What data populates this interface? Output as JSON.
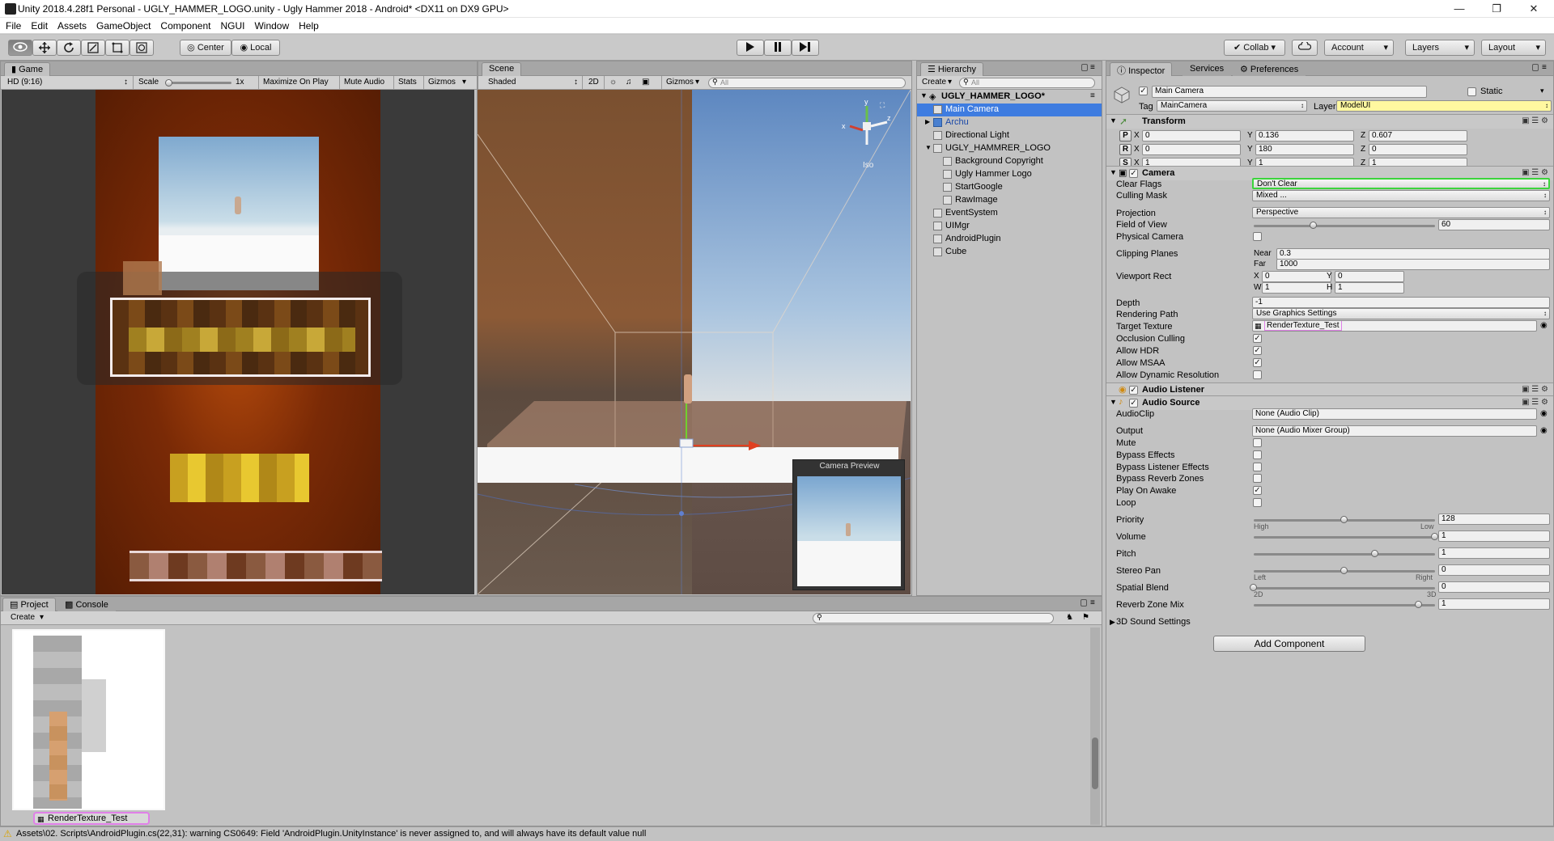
{
  "titlebar": {
    "title": "Unity 2018.4.28f1 Personal - UGLY_HAMMER_LOGO.unity - Ugly Hammer 2018 - Android* <DX11 on DX9 GPU>"
  },
  "window_controls": {
    "minimize": "—",
    "maximize": "❐",
    "close": "✕"
  },
  "menu": [
    "File",
    "Edit",
    "Assets",
    "GameObject",
    "Component",
    "NGUI",
    "Window",
    "Help"
  ],
  "toolbar": {
    "tools": [
      "view-tool-icon",
      "move-tool-icon",
      "rotate-tool-icon",
      "scale-tool-icon",
      "rect-tool-icon",
      "transform-tool-icon"
    ],
    "pivot_label": "Center",
    "space_label": "Local",
    "collab_label": "Collab",
    "account_label": "Account",
    "layers_label": "Layers",
    "layout_label": "Layout"
  },
  "game": {
    "tab": "Game",
    "resolution": "HD (9:16)",
    "scale_label": "Scale",
    "scale_value": "1x",
    "maximize": "Maximize On Play",
    "mute": "Mute Audio",
    "stats": "Stats",
    "gizmos": "Gizmos"
  },
  "scene": {
    "tab": "Scene",
    "shading": "Shaded",
    "mode_2d": "2D",
    "gizmos": "Gizmos",
    "search_placeholder": "All",
    "persp_label": "Iso",
    "preview_title": "Camera Preview"
  },
  "hierarchy": {
    "tab": "Hierarchy",
    "create": "Create",
    "search_placeholder": "All",
    "scene_name": "UGLY_HAMMER_LOGO*",
    "items": [
      {
        "label": "Main Camera",
        "depth": 1,
        "selected": true,
        "prefab": false,
        "foldout": ""
      },
      {
        "label": "Archu",
        "depth": 1,
        "selected": false,
        "prefab": true,
        "foldout": "▶"
      },
      {
        "label": "Directional Light",
        "depth": 1,
        "selected": false,
        "prefab": false,
        "foldout": ""
      },
      {
        "label": "UGLY_HAMMRER_LOGO",
        "depth": 1,
        "selected": false,
        "prefab": false,
        "foldout": "▼"
      },
      {
        "label": "Background Copyright",
        "depth": 2,
        "selected": false,
        "prefab": false,
        "foldout": ""
      },
      {
        "label": "Ugly Hammer Logo",
        "depth": 2,
        "selected": false,
        "prefab": false,
        "foldout": ""
      },
      {
        "label": "StartGoogle",
        "depth": 2,
        "selected": false,
        "prefab": false,
        "foldout": ""
      },
      {
        "label": "RawImage",
        "depth": 2,
        "selected": false,
        "prefab": false,
        "foldout": ""
      },
      {
        "label": "EventSystem",
        "depth": 1,
        "selected": false,
        "prefab": false,
        "foldout": ""
      },
      {
        "label": "UIMgr",
        "depth": 1,
        "selected": false,
        "prefab": false,
        "foldout": ""
      },
      {
        "label": "AndroidPlugin",
        "depth": 1,
        "selected": false,
        "prefab": false,
        "foldout": ""
      },
      {
        "label": "Cube",
        "depth": 1,
        "selected": false,
        "prefab": false,
        "foldout": ""
      }
    ]
  },
  "inspector": {
    "tabs": [
      "Inspector",
      "Services",
      "Preferences"
    ],
    "object_name": "Main Camera",
    "static_label": "Static",
    "tag_label": "Tag",
    "tag_value": "MainCamera",
    "layer_label": "Layer",
    "layer_value": "ModelUI",
    "transform": {
      "title": "Transform",
      "rows": [
        {
          "btn": "P",
          "x": "0",
          "y": "0.136",
          "z": "0.607"
        },
        {
          "btn": "R",
          "x": "0",
          "y": "180",
          "z": "0"
        },
        {
          "btn": "S",
          "x": "1",
          "y": "1",
          "z": "1"
        }
      ],
      "axis": [
        "X",
        "Y",
        "Z"
      ]
    },
    "camera": {
      "title": "Camera",
      "clear_flags_label": "Clear Flags",
      "clear_flags": "Don't Clear",
      "culling_mask_label": "Culling Mask",
      "culling_mask": "Mixed ...",
      "projection_label": "Projection",
      "projection": "Perspective",
      "fov_label": "Field of View",
      "fov": "60",
      "fov_fraction": 0.33,
      "physical_label": "Physical Camera",
      "clipping_label": "Clipping Planes",
      "near_label": "Near",
      "near": "0.3",
      "far_label": "Far",
      "far": "1000",
      "viewport_label": "Viewport Rect",
      "vp_x": "0",
      "vp_y": "0",
      "vp_w": "1",
      "vp_h": "1",
      "vp_x_lbl": "X",
      "vp_y_lbl": "Y",
      "vp_w_lbl": "W",
      "vp_h_lbl": "H",
      "depth_label": "Depth",
      "depth": "-1",
      "rendering_path_label": "Rendering Path",
      "rendering_path": "Use Graphics Settings",
      "target_texture_label": "Target Texture",
      "target_texture": "RenderTexture_Test",
      "occlusion_label": "Occlusion Culling",
      "hdr_label": "Allow HDR",
      "msaa_label": "Allow MSAA",
      "dynres_label": "Allow Dynamic Resolution",
      "checks": {
        "physical": false,
        "occlusion": true,
        "hdr": true,
        "msaa": true,
        "dynres": false
      }
    },
    "audio_listener": {
      "title": "Audio Listener"
    },
    "audio_source": {
      "title": "Audio Source",
      "clip_label": "AudioClip",
      "clip": "None (Audio Clip)",
      "output_label": "Output",
      "output": "None (Audio Mixer Group)",
      "mute_label": "Mute",
      "bypass_effects_label": "Bypass Effects",
      "bypass_listener_label": "Bypass Listener Effects",
      "bypass_reverb_label": "Bypass Reverb Zones",
      "play_on_awake_label": "Play On Awake",
      "loop_label": "Loop",
      "checks": {
        "mute": false,
        "bypass_effects": false,
        "bypass_listener": false,
        "bypass_reverb": false,
        "play_on_awake": true,
        "loop": false
      },
      "priority_label": "Priority",
      "priority": "128",
      "priority_fraction": 0.5,
      "high": "High",
      "low": "Low",
      "volume_label": "Volume",
      "volume": "1",
      "volume_fraction": 1.0,
      "pitch_label": "Pitch",
      "pitch": "1",
      "pitch_fraction": 0.67,
      "stereo_label": "Stereo Pan",
      "stereo": "0",
      "stereo_fraction": 0.5,
      "left": "Left",
      "right": "Right",
      "spatial_label": "Spatial Blend",
      "spatial": "0",
      "spatial_fraction": 0.0,
      "two_d": "2D",
      "three_d": "3D",
      "reverb_label": "Reverb Zone Mix",
      "reverb": "1",
      "reverb_fraction": 0.91,
      "sound3d_label": "3D Sound Settings"
    },
    "add_component": "Add Component"
  },
  "project": {
    "tabs": [
      "Project",
      "Console"
    ],
    "create": "Create",
    "asset_name": "RenderTexture_Test"
  },
  "status": {
    "message": "Assets\\02. Scripts\\AndroidPlugin.cs(22,31): warning CS0649: Field 'AndroidPlugin.UnityInstance' is never assigned to, and will always have its default value null"
  },
  "colors": {
    "selection": "#3e7ce0",
    "highlight_green": "#3cd43c",
    "highlight_yellow": "#fff8a0",
    "highlight_pink": "#e080e8"
  }
}
